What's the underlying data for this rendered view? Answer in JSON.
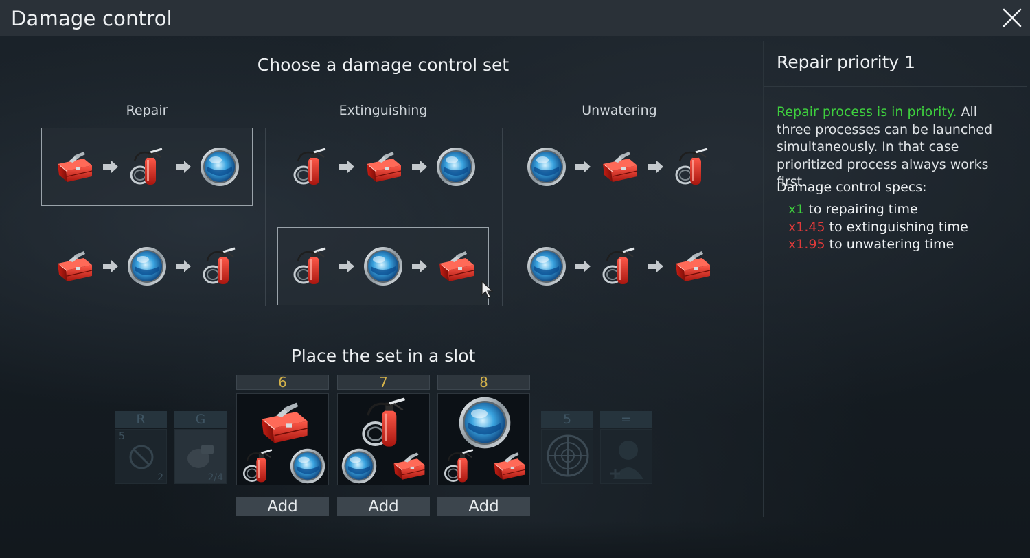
{
  "window": {
    "title": "Damage control"
  },
  "chooser": {
    "title": "Choose a damage control set",
    "columns": [
      "Repair",
      "Extinguishing",
      "Unwatering"
    ]
  },
  "sets": [
    {
      "column": 0,
      "row": 0,
      "sequence": [
        "toolbox-icon",
        "extinguisher-icon",
        "pump-icon"
      ],
      "selected": true
    },
    {
      "column": 0,
      "row": 1,
      "sequence": [
        "toolbox-icon",
        "pump-icon",
        "extinguisher-icon"
      ],
      "selected": false
    },
    {
      "column": 1,
      "row": 0,
      "sequence": [
        "extinguisher-icon",
        "toolbox-icon",
        "pump-icon"
      ],
      "selected": false
    },
    {
      "column": 1,
      "row": 1,
      "sequence": [
        "extinguisher-icon",
        "pump-icon",
        "toolbox-icon"
      ],
      "selected": true
    },
    {
      "column": 2,
      "row": 0,
      "sequence": [
        "pump-icon",
        "toolbox-icon",
        "extinguisher-icon"
      ],
      "selected": false
    },
    {
      "column": 2,
      "row": 1,
      "sequence": [
        "pump-icon",
        "extinguisher-icon",
        "toolbox-icon"
      ],
      "selected": false
    }
  ],
  "slots": {
    "title": "Place the set in a slot",
    "faded_left": [
      {
        "label": "R",
        "num_top": "5",
        "num_bottom": "2"
      },
      {
        "label": "G",
        "num_bottom": "2/4"
      }
    ],
    "items": [
      {
        "number": "6",
        "add_label": "Add",
        "main": "toolbox-icon",
        "sub": [
          "extinguisher-icon",
          "pump-icon"
        ]
      },
      {
        "number": "7",
        "add_label": "Add",
        "main": "extinguisher-icon",
        "sub": [
          "pump-icon",
          "toolbox-icon"
        ]
      },
      {
        "number": "8",
        "add_label": "Add",
        "main": "pump-icon",
        "sub": [
          "extinguisher-icon",
          "toolbox-icon"
        ]
      }
    ],
    "faded_right": [
      {
        "label": "5"
      },
      {
        "label": "="
      }
    ]
  },
  "info": {
    "title": "Repair priority 1",
    "highlight": "Repair process is in priority.",
    "description": " All three processes can be launched simultaneously. In that case prioritized process always works first.",
    "specs_title": "Damage control specs:",
    "specs": [
      {
        "mult": "x1",
        "text": " to repairing time",
        "color": "#3ecf3e"
      },
      {
        "mult": "x1.45",
        "text": " to extinguishing time",
        "color": "#e03a3a"
      },
      {
        "mult": "x1.95",
        "text": " to unwatering time",
        "color": "#e03a3a"
      }
    ]
  }
}
